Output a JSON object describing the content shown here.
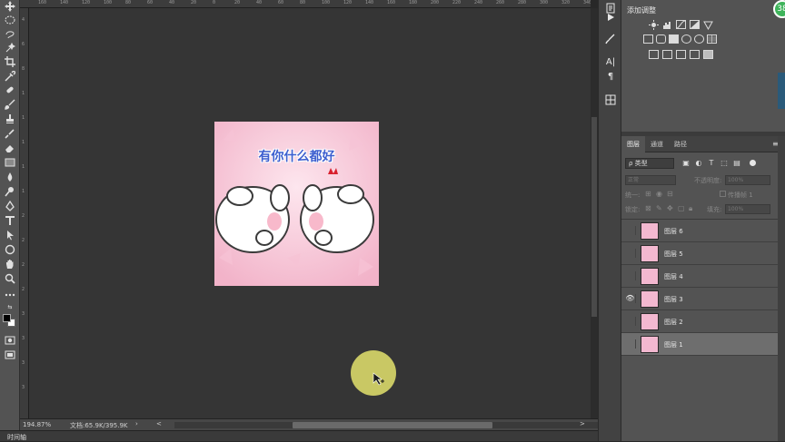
{
  "toolbar": {
    "tools": [
      "move-tool",
      "marquee-tool",
      "lasso-tool",
      "quick-select-tool",
      "crop-tool",
      "eyedropper-tool",
      "healing-brush-tool",
      "brush-tool",
      "clone-stamp-tool",
      "history-brush-tool",
      "eraser-tool",
      "gradient-tool",
      "blur-tool",
      "dodge-tool",
      "pen-tool",
      "type-tool",
      "path-select-tool",
      "shape-tool",
      "hand-tool",
      "zoom-tool",
      "more-tools",
      "color-swatches",
      "quick-mask",
      "screen-mode"
    ],
    "foreground_color": "#000000",
    "background_color": "#ffffff"
  },
  "ruler": {
    "top_ticks": [
      "160",
      "140",
      "120",
      "100",
      "80",
      "60",
      "40",
      "20",
      "0",
      "20",
      "40",
      "60",
      "80",
      "100",
      "120",
      "140",
      "160",
      "180",
      "200",
      "220",
      "240",
      "260",
      "280",
      "300",
      "320",
      "340"
    ],
    "left_ticks": [
      "4",
      "6",
      "8",
      "1",
      "1",
      "1",
      "1",
      "1",
      "2",
      "2",
      "2",
      "2",
      "3",
      "3",
      "3",
      "3"
    ]
  },
  "canvas": {
    "artwork_caption": "有你什么都好",
    "cursor_highlight_color": "#c9c864"
  },
  "status": {
    "zoom": "194.87%",
    "doc_size": "文档:65.9K/395.9K",
    "nav_left": "<",
    "nav_right": ">"
  },
  "timeline": {
    "label": "时间轴"
  },
  "midcol": {
    "icons": [
      "history-icon",
      "play-icon",
      "brush-settings-icon",
      "character-icon",
      "paragraph-icon",
      "styles-icon"
    ]
  },
  "adjustments": {
    "title": "添加调整",
    "badge": "38"
  },
  "layers_panel": {
    "tabs": [
      "图层",
      "通道",
      "路径"
    ],
    "active_tab": "图层",
    "filter_label": "ρ 类型",
    "blend_mode": "正常",
    "opacity_label": "不透明度:",
    "opacity_value": "100%",
    "unify_label": "统一:",
    "propagate_label": "传播帧 1",
    "lock_label": "锁定:",
    "fill_label": "填充:",
    "fill_value": "100%",
    "layers": [
      {
        "name": "图层 6",
        "visible": false,
        "selected": false
      },
      {
        "name": "图层 5",
        "visible": false,
        "selected": false
      },
      {
        "name": "图层 4",
        "visible": false,
        "selected": false
      },
      {
        "name": "图层 3",
        "visible": true,
        "selected": false
      },
      {
        "name": "图层 2",
        "visible": false,
        "selected": false
      },
      {
        "name": "图层 1",
        "visible": false,
        "selected": true
      }
    ]
  }
}
